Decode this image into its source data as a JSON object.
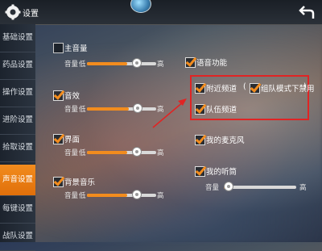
{
  "header": {
    "title": "设置"
  },
  "sidebar": {
    "items": [
      {
        "label": "基础设置"
      },
      {
        "label": "药品设置"
      },
      {
        "label": "操作设置"
      },
      {
        "label": "进阶设置"
      },
      {
        "label": "拾取设置"
      },
      {
        "label": "声音设置"
      },
      {
        "label": "每键设置"
      },
      {
        "label": "战队设置"
      }
    ],
    "active_index": 5
  },
  "audio": {
    "main_volume": {
      "label": "主音量",
      "checked": false,
      "vol_label": "音量",
      "low": "低",
      "high": "高",
      "level": 0.58
    },
    "sfx": {
      "label": "音效",
      "checked": true,
      "vol_label": "音量",
      "low": "低",
      "high": "高",
      "level": 0.6
    },
    "ui": {
      "label": "界面",
      "checked": true,
      "vol_label": "音量",
      "low": "低",
      "high": "高",
      "level": 0.58
    },
    "bgm": {
      "label": "背景音乐",
      "checked": true,
      "vol_label": "音量",
      "low": "低",
      "high": "高",
      "level": 0.58
    }
  },
  "voice": {
    "title": "语音功能",
    "title_checked": true,
    "nearby": {
      "label": "附近频道",
      "checked": true
    },
    "paren_open": "(",
    "team_mode_disable": {
      "label": "组队模式下禁用",
      "checked": true
    },
    "paren_close": ")",
    "team_channel": {
      "label": "队伍频道",
      "checked": true
    },
    "my_mic": {
      "label": "我的麦克风",
      "checked": true
    },
    "my_listen": {
      "label": "我的听筒",
      "checked": true
    },
    "listen_volume": {
      "vol_label": "音量",
      "high": "高",
      "level": 0.02
    }
  },
  "colors": {
    "accent": "#f28c1e",
    "highlight_box": "#e02424"
  },
  "icons": {
    "settings": "gear-icon",
    "back": "return-arrow-icon"
  }
}
